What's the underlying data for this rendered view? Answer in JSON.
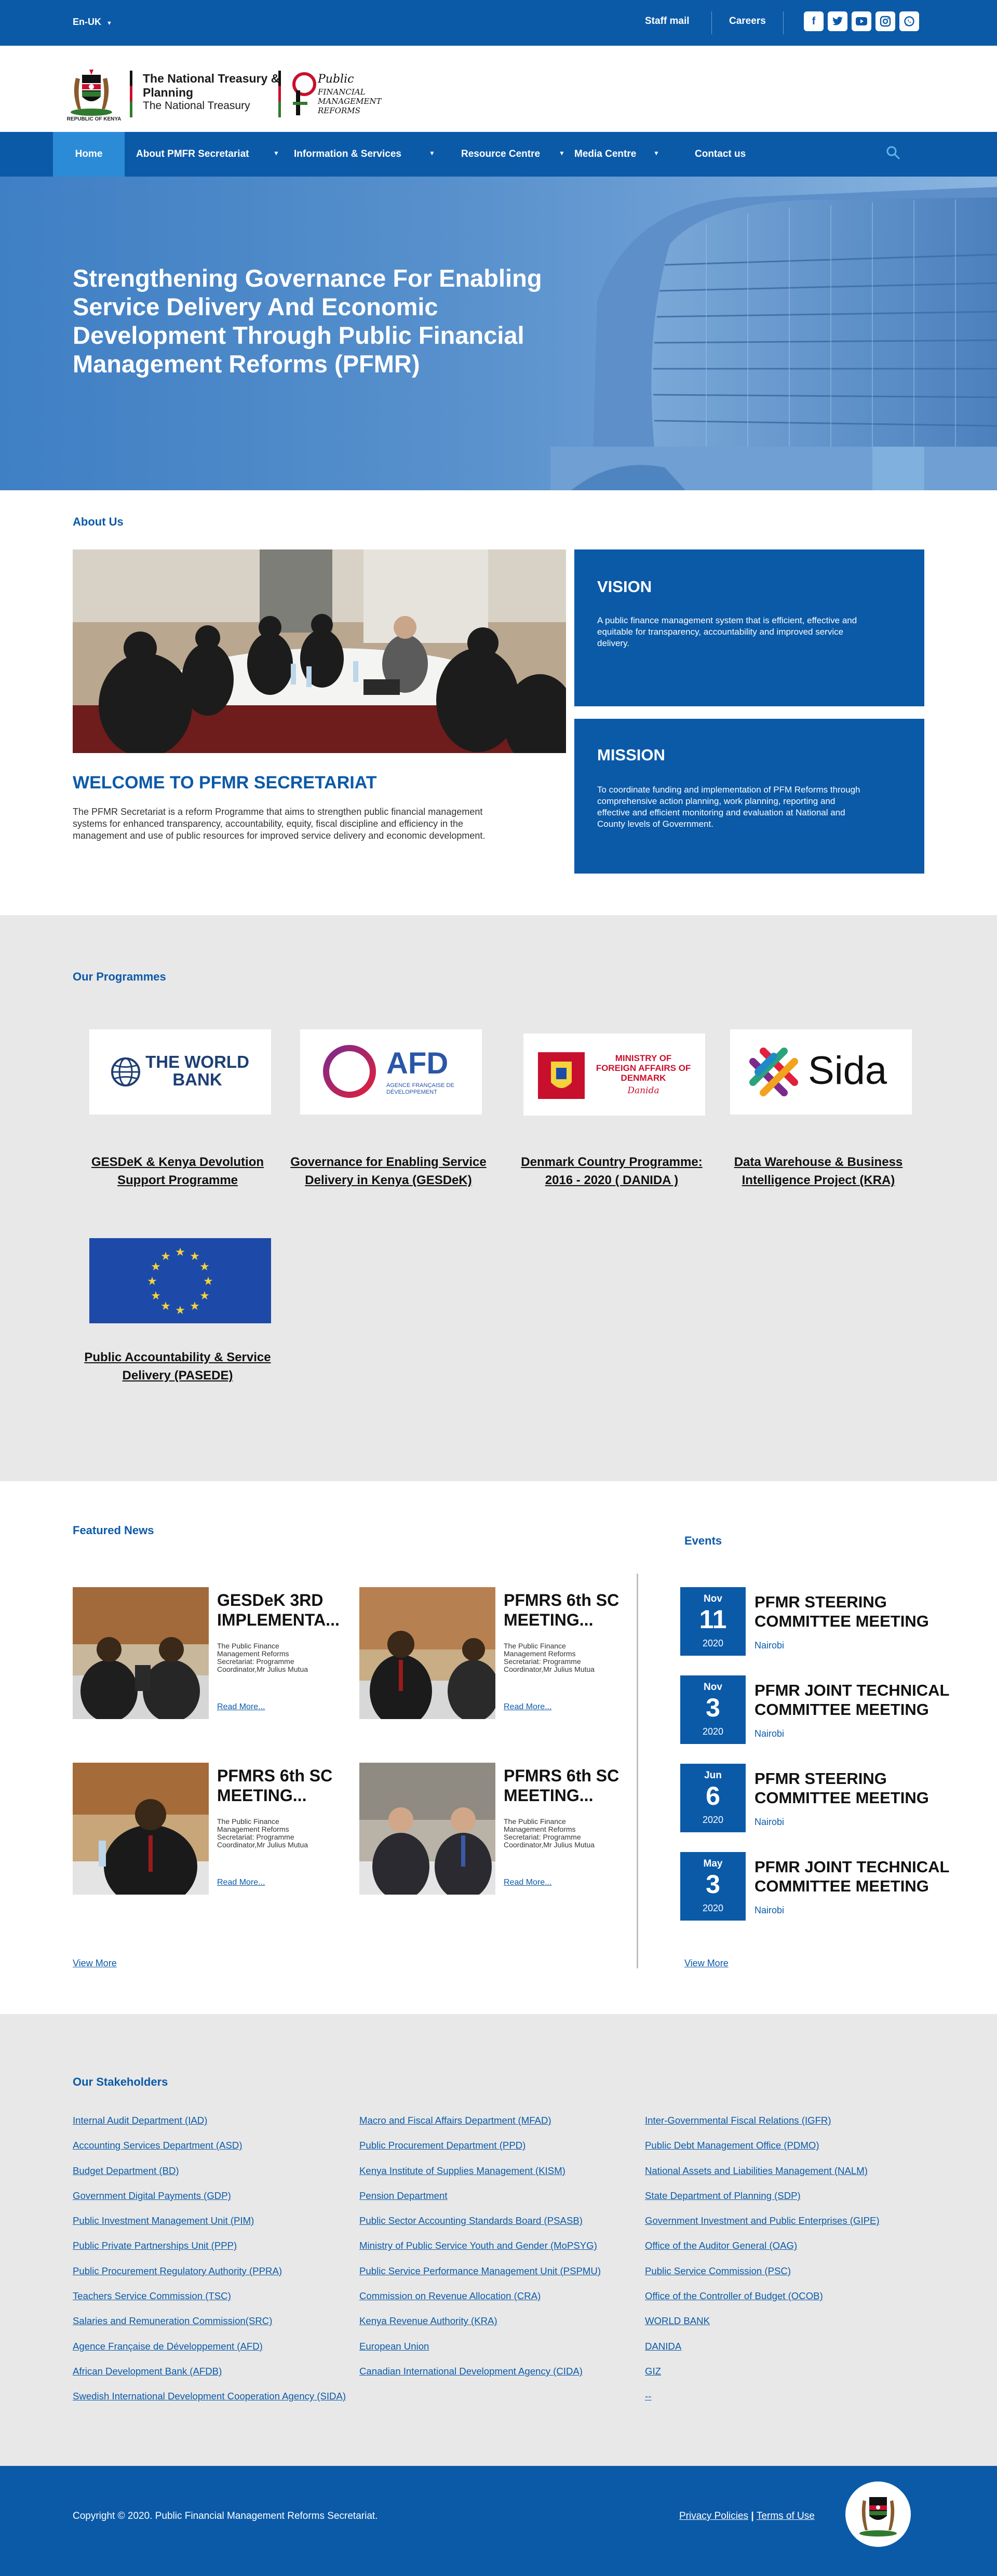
{
  "topbar": {
    "language": "En-UK",
    "staff_mail": "Staff mail",
    "careers": "Careers",
    "social": [
      "facebook-icon",
      "twitter-icon",
      "youtube-icon",
      "instagram-icon",
      "whatsapp-icon"
    ]
  },
  "logo": {
    "crest_caption": "REPUBLIC OF KENYA",
    "org_name": "The National Treasury & Planning",
    "org_sub": "The National Treasury",
    "pfmr_line1": "Public",
    "pfmr_line2": "FINANCIAL",
    "pfmr_line3": "MANAGEMENT",
    "pfmr_line4": "REFORMS"
  },
  "nav": {
    "home": "Home",
    "about": "About PMFR Secretariat",
    "info": "Information & Services",
    "resource": "Resource Centre",
    "media": "Media Centre",
    "contact": "Contact us"
  },
  "hero": {
    "title": "Strengthening Governance For Enabling Service Delivery And Economic Development Through Public Financial Management Reforms (PFMR)"
  },
  "about": {
    "section_title": "About Us",
    "welcome_title": "WELCOME TO PFMR SECRETARIAT",
    "welcome_text": "The PFMR Secretariat is a reform Programme that aims to strengthen public financial management systems for enhanced transparency, accountability, equity, fiscal discipline and efficiency in the management and use of public resources for improved service delivery and economic development.",
    "vision_title": "VISION",
    "vision_text": "A public finance management system that is efficient, effective and equitable for transparency, accountability and improved service delivery.",
    "mission_title": "MISSION",
    "mission_text": "To coordinate funding and implementation of PFM Reforms through comprehensive action planning, work planning, reporting and effective and efficient monitoring and evaluation at National and County levels of Government."
  },
  "programmes": {
    "section_title": "Our Programmes",
    "items": [
      {
        "logo_text": "THE WORLD BANK",
        "title": "GESDeK & Kenya Devolution Support Programme"
      },
      {
        "logo_text": "AFD",
        "logo_sub": "AGENCE FRANÇAISE DE DÉVELOPPEMENT",
        "title": "Governance for Enabling Service Delivery in Kenya (GESDeK)"
      },
      {
        "logo_text": "MINISTRY OF FOREIGN AFFAIRS OF DENMARK",
        "logo_sub": "Danida",
        "title": "Denmark Country Programme: 2016 - 2020 ( DANIDA )"
      },
      {
        "logo_text": "Sida",
        "title": "Data Warehouse & Business Intelligence Project (KRA)"
      },
      {
        "logo_text": "",
        "title": "Public Accountability & Service Delivery (PASEDE)"
      }
    ]
  },
  "news": {
    "section_title": "Featured News",
    "items": [
      {
        "title": "GESDeK 3RD IMPLEMENTA...",
        "text": "The Public Finance Management Reforms Secretariat: Programme Coordinator,Mr Julius Mutua",
        "more": "Read More..."
      },
      {
        "title": "PFMRS 6th SC MEETING...",
        "text": "The Public Finance Management Reforms Secretariat: Programme Coordinator,Mr Julius Mutua",
        "more": "Read More..."
      },
      {
        "title": "PFMRS 6th SC MEETING...",
        "text": "The Public Finance Management Reforms Secretariat: Programme Coordinator,Mr Julius Mutua",
        "more": "Read More..."
      },
      {
        "title": "PFMRS 6th SC MEETING...",
        "text": "The Public Finance Management Reforms Secretariat: Programme Coordinator,Mr Julius Mutua",
        "more": "Read More..."
      }
    ],
    "view_more": "View More"
  },
  "events": {
    "section_title": "Events",
    "items": [
      {
        "month": "Nov",
        "day": "11",
        "year": "2020",
        "title": "PFMR STEERING COMMITTEE MEETING",
        "location": "Nairobi"
      },
      {
        "month": "Nov",
        "day": "3",
        "year": "2020",
        "title": "PFMR JOINT TECHNICAL COMMITTEE  MEETING",
        "location": "Nairobi"
      },
      {
        "month": "Jun",
        "day": "6",
        "year": "2020",
        "title": "PFMR STEERING COMMITTEE MEETING",
        "location": "Nairobi"
      },
      {
        "month": "May",
        "day": "3",
        "year": "2020",
        "title": "PFMR JOINT TECHNICAL COMMITTEE  MEETING",
        "location": "Nairobi"
      }
    ],
    "view_more": "View More"
  },
  "stakeholders": {
    "section_title": "Our Stakeholders",
    "col1": [
      "Internal Audit Department (IAD)",
      "Accounting Services Department (ASD)",
      "Budget Department (BD)",
      "Government Digital Payments (GDP)",
      "Public Investment Management Unit (PIM)",
      "Public Private Partnerships Unit (PPP)",
      "Public Procurement Regulatory Authority (PPRA)",
      "Teachers Service Commission (TSC)",
      "Salaries and Remuneration Commission(SRC)",
      "Agence Française de Développement (AFD)",
      "African Development Bank (AFDB)",
      "Swedish International Development Cooperation Agency (SIDA)"
    ],
    "col2": [
      "Macro and Fiscal Affairs Department (MFAD)",
      "Public Procurement Department (PPD)",
      "Kenya Institute of Supplies Management (KISM)",
      "Pension Department",
      "Public Sector Accounting Standards Board (PSASB)",
      "Ministry of Public Service Youth and Gender (MoPSYG)",
      "Public Service Performance Management Unit (PSPMU)",
      "Commission on Revenue Allocation (CRA)",
      "Kenya Revenue Authority (KRA)",
      "European Union",
      "Canadian International Development Agency (CIDA)"
    ],
    "col3": [
      "Inter-Governmental Fiscal Relations (IGFR)",
      "Public Debt Management Office (PDMO)",
      "National Assets and Liabilities Management (NALM)",
      "State Department of Planning (SDP)",
      "Government Investment and Public Enterprises (GIPE)",
      "Office of the Auditor General (OAG)",
      "Public Service Commission (PSC)",
      "Office of the Controller of Budget (OCOB)",
      "WORLD BANK",
      "DANIDA",
      "GIZ",
      "--"
    ]
  },
  "footer": {
    "copyright": "Copyright © 2020. Public Financial Management Reforms Secretariat.",
    "privacy": "Privacy Policies",
    "sep": " | ",
    "terms": "Terms of Use"
  },
  "colors": {
    "primary": "#0b5aa8",
    "nav_active": "#2c8bd6",
    "section_grey": "#e8e8e8"
  }
}
